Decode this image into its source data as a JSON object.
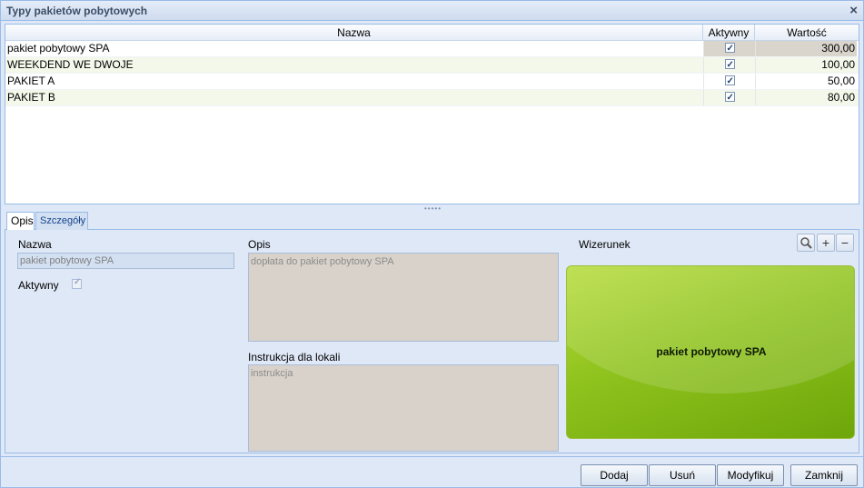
{
  "window": {
    "title": "Typy pakietów pobytowych",
    "close_glyph": "×"
  },
  "grid": {
    "columns": [
      "Nazwa",
      "Aktywny",
      "Wartość"
    ],
    "rows": [
      {
        "name": "pakiet pobytowy SPA",
        "active": true,
        "value": "300,00"
      },
      {
        "name": "WEEKDEND WE DWOJE",
        "active": true,
        "value": "100,00"
      },
      {
        "name": "PAKIET A",
        "active": true,
        "value": "50,00"
      },
      {
        "name": "PAKIET B",
        "active": true,
        "value": "80,00"
      }
    ]
  },
  "tabs": {
    "opis": "Opis",
    "szczegoly": "Szczegóły"
  },
  "details": {
    "name_label": "Nazwa",
    "name_value": "pakiet pobytowy SPA",
    "active_label": "Aktywny",
    "active_checked": true,
    "desc_label": "Opis",
    "desc_value": "dopłata do pakiet pobytowy SPA",
    "instr_label": "Instrukcja dla lokali",
    "instr_value": "instrukcja",
    "image_label": "Wizerunek",
    "image_text": "pakiet pobytowy SPA"
  },
  "toolbar_icons": [
    "search-icon",
    "plus-icon",
    "minus-icon"
  ],
  "buttons": {
    "add": "Dodaj",
    "remove": "Usuń",
    "modify": "Modyfikuj",
    "close": "Zamknij"
  },
  "colors": {
    "image_green": "#8ec21d",
    "window_bg": "#dfe8f6",
    "border": "#99bbe8"
  }
}
